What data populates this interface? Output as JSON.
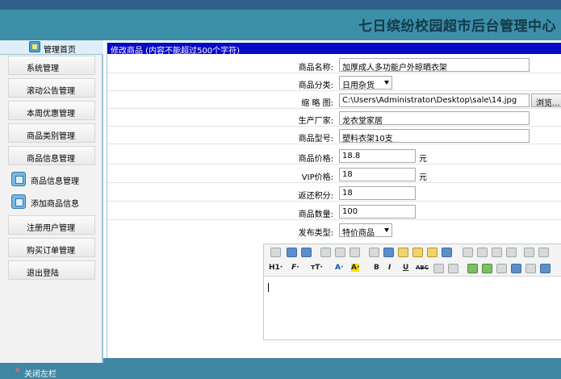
{
  "header": {
    "title": "七日缤纷校园超市后台管理中心"
  },
  "sidebar": {
    "home_label": "管理首页",
    "items": [
      {
        "label": "系统管理"
      },
      {
        "label": "滚动公告管理"
      },
      {
        "label": "本周优惠管理"
      },
      {
        "label": "商品类别管理"
      },
      {
        "label": "商品信息管理"
      }
    ],
    "sub_items": [
      {
        "label": "商品信息管理",
        "icon": "product-list-icon"
      },
      {
        "label": "添加商品信息",
        "icon": "add-product-icon"
      }
    ],
    "items_after": [
      {
        "label": "注册用户管理"
      },
      {
        "label": "购买订单管理"
      },
      {
        "label": "退出登陆"
      }
    ],
    "close_label": "关闭左栏"
  },
  "panel": {
    "heading": "修改商品  (内容不能超过500个字符)"
  },
  "form": {
    "name_label": "商品名称:",
    "name_value": "加厚成人多功能户外晾晒衣架",
    "category_label": "商品分类:",
    "category_value": "日用杂货",
    "thumb_label": "缩 略 图:",
    "thumb_value": "C:\\Users\\Administrator\\Desktop\\sale\\14.jpg",
    "browse_label": "浏览...",
    "maker_label": "生产厂家:",
    "maker_value": "龙衣堂家居",
    "model_label": "商品型号:",
    "model_value": "塑料衣架10支",
    "price_label": "商品价格:",
    "price_value": "18.8",
    "price_unit": "元",
    "vip_label": "VIP价格:",
    "vip_value": "18",
    "vip_unit": "元",
    "points_label": "返还积分:",
    "points_value": "18",
    "qty_label": "商品数量:",
    "qty_value": "100",
    "type_label": "发布类型:",
    "type_value": "特价商品"
  },
  "editor": {
    "heading_label": "H1·",
    "font_label": "F·",
    "size_label": "тT·",
    "fontcolor_label": "A·",
    "bgcolor_label": "A·",
    "bold_label": "B",
    "italic_label": "I",
    "underline_label": "U",
    "strike_label": "ABC"
  },
  "colors": {
    "banner": "#3d8fa8",
    "panel_header": "#0909c8",
    "topbar": "#2f5f88"
  }
}
